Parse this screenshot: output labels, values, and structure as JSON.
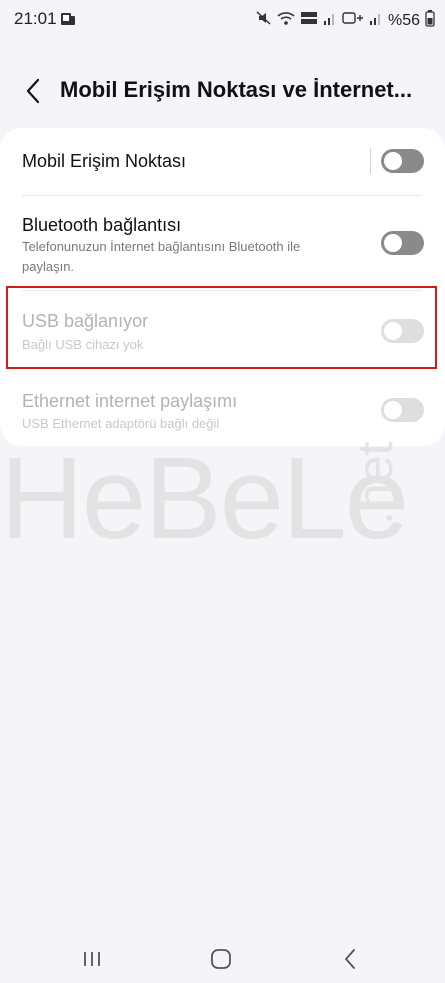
{
  "status_bar": {
    "time": "21:01",
    "battery": "%56",
    "icons": [
      "mute-icon",
      "wifi-icon",
      "volte-icon",
      "signal-icon",
      "hd-icon",
      "signal-icon",
      "battery-icon"
    ]
  },
  "header": {
    "back_icon": "chevron-left-icon",
    "title": "Mobil Erişim Noktası ve İnternet..."
  },
  "settings": {
    "hotspot": {
      "title": "Mobil Erişim Noktası",
      "enabled": true,
      "checked": false
    },
    "bluetooth": {
      "title": "Bluetooth bağlantısı",
      "subtitle": "Telefonunuzun İnternet bağlantısını Bluetooth ile paylaşın.",
      "enabled": true,
      "checked": false
    },
    "usb": {
      "title": "USB bağlanıyor",
      "subtitle": "Bağlı USB cihazı yok",
      "enabled": false,
      "checked": false
    },
    "ethernet": {
      "title": "Ethernet internet paylaşımı",
      "subtitle": "USB Ethernet adaptörü bağlı değil",
      "enabled": false,
      "checked": false
    }
  },
  "watermark": {
    "text": "HeBeLe",
    "suffix": ".net"
  },
  "nav": {
    "icons": [
      "recents-icon",
      "home-icon",
      "back-icon"
    ]
  },
  "colors": {
    "background": "#f5f4f8",
    "card": "#ffffff",
    "toggle_off": "#8a8a8a",
    "toggle_disabled": "#dedede",
    "highlight": "#d21b1b"
  }
}
